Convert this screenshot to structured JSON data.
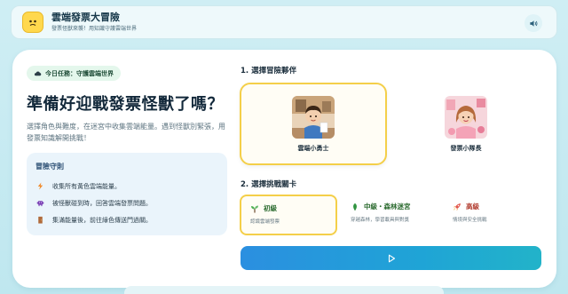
{
  "header": {
    "title": "雲端發票大冒險",
    "subtitle": "發票怪獸來襲！用知識守護雲端世界",
    "logo_icon": "worried-face-icon",
    "sound_icon": "speaker-icon"
  },
  "task": {
    "label": "今日任務：守護雲端世界",
    "icon": "cloud-icon"
  },
  "headline": "準備好迎戰發票怪獸了嗎？",
  "intro": "選擇角色與難度，在迷宮中收集雲端能量。遇到怪獸別緊張，用發票知識解開挑戰！",
  "rules": {
    "title": "冒險守則",
    "items": [
      {
        "text": "收集所有黃色雲端能量。",
        "icon": "lightning-icon"
      },
      {
        "text": "被怪獸碰到時，回答雲端發票問題。",
        "icon": "monster-icon"
      },
      {
        "text": "集滿能量後，前往綠色傳送門過關。",
        "icon": "door-icon"
      }
    ]
  },
  "partners": {
    "title": "1. 選擇冒險夥伴",
    "items": [
      {
        "name": "雲端小勇士",
        "selected": true
      },
      {
        "name": "發票小隊長",
        "selected": false
      }
    ]
  },
  "levels": {
    "title": "2. 選擇挑戰關卡",
    "items": [
      {
        "name": "初級",
        "desc": "認識雲端發票",
        "icon": "sprout-icon",
        "color": "#2a7a3a",
        "selected": true
      },
      {
        "name": "中級・森林迷宮",
        "desc": "穿越森林，學習載具與對獎",
        "icon": "leaf-icon",
        "color": "#2a7a3a",
        "selected": false
      },
      {
        "name": "高級",
        "desc": "情境與安全挑戰",
        "icon": "rocket-icon",
        "color": "#b0392c",
        "selected": false
      }
    ]
  },
  "start_button": {
    "icon": "play-icon"
  }
}
